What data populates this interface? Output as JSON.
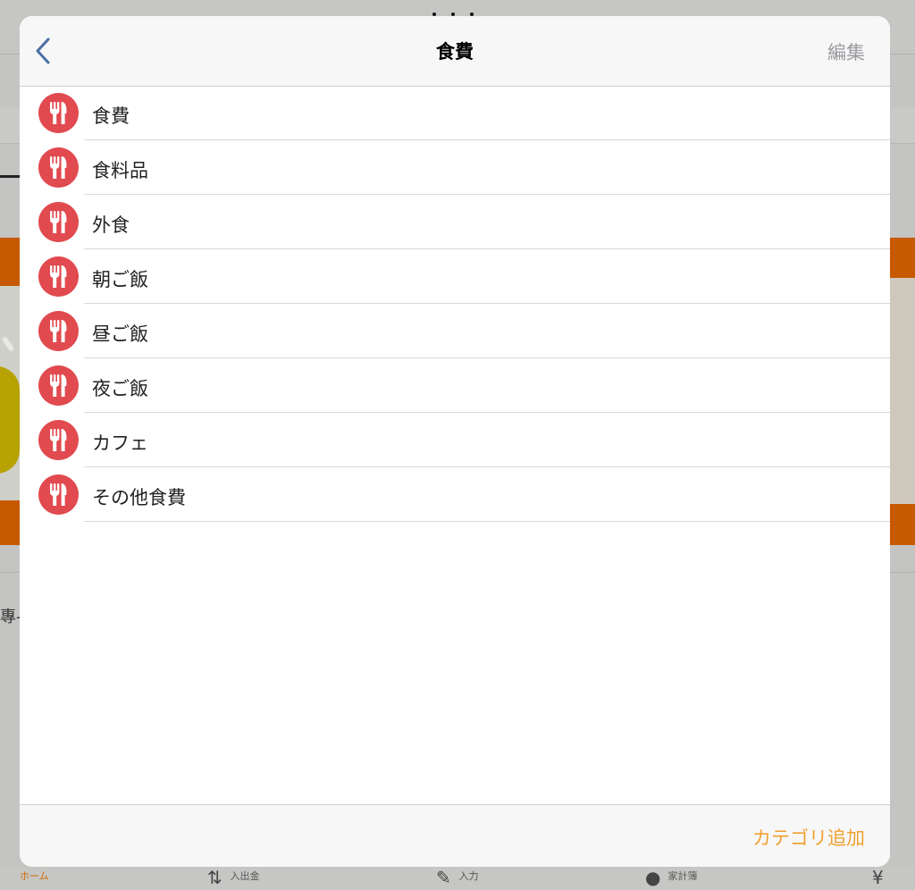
{
  "modal": {
    "title": "食費",
    "edit_label": "編集",
    "add_category_label": "カテゴリ追加",
    "categories": [
      {
        "label": "食費",
        "icon": "fork-knife-icon"
      },
      {
        "label": "食料品",
        "icon": "fork-knife-icon"
      },
      {
        "label": "外食",
        "icon": "fork-knife-icon"
      },
      {
        "label": "朝ご飯",
        "icon": "fork-knife-icon"
      },
      {
        "label": "昼ご飯",
        "icon": "fork-knife-icon"
      },
      {
        "label": "夜ご飯",
        "icon": "fork-knife-icon"
      },
      {
        "label": "カフェ",
        "icon": "fork-knife-icon"
      },
      {
        "label": "その他食費",
        "icon": "fork-knife-icon"
      }
    ]
  },
  "background": {
    "mid_text": "專-N",
    "tabs": [
      {
        "label": "ホーム"
      },
      {
        "label": "入出金"
      },
      {
        "label": "入力"
      },
      {
        "label": "家計簿"
      }
    ]
  },
  "colors": {
    "accent": "#f0a030",
    "category_icon_bg": "#e14a4f",
    "edit_text": "#9a9aa0",
    "banner": "#c75a00"
  }
}
